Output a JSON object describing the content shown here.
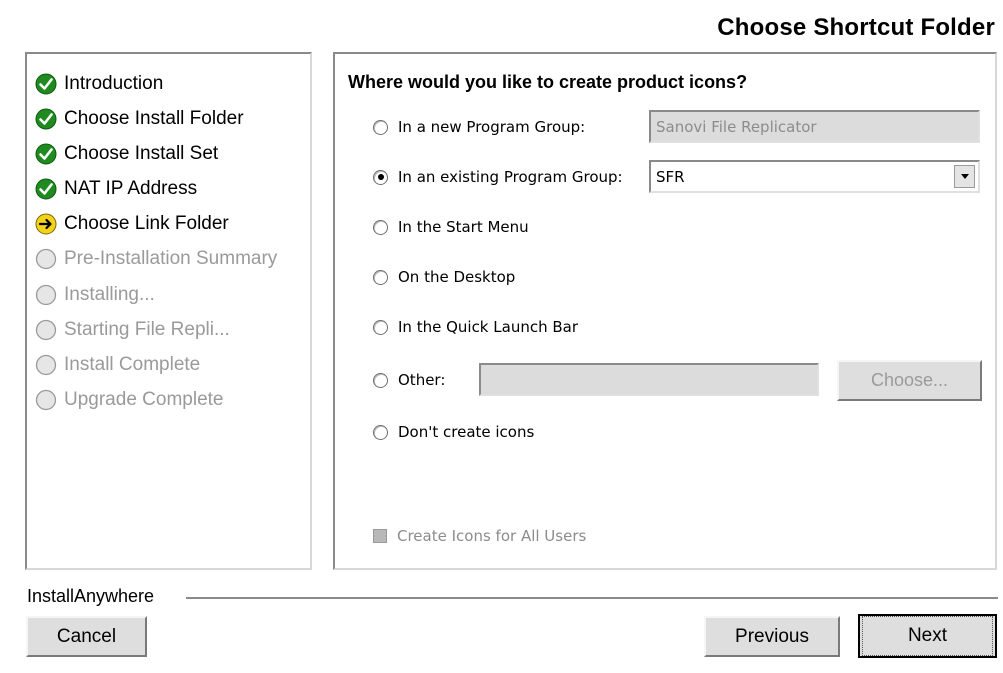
{
  "header": {
    "title": "Choose Shortcut Folder"
  },
  "steps": [
    {
      "label": "Introduction",
      "state": "done"
    },
    {
      "label": "Choose Install Folder",
      "state": "done"
    },
    {
      "label": "Choose Install Set",
      "state": "done"
    },
    {
      "label": "NAT IP Address",
      "state": "done"
    },
    {
      "label": "Choose Link Folder",
      "state": "current"
    },
    {
      "label": "Pre-Installation Summary",
      "state": "pending"
    },
    {
      "label": "Installing...",
      "state": "pending"
    },
    {
      "label": "Starting File Repli...",
      "state": "pending"
    },
    {
      "label": "Install Complete",
      "state": "pending"
    },
    {
      "label": "Upgrade Complete",
      "state": "pending"
    }
  ],
  "icons": {
    "done": "green-check-circle-icon",
    "current": "yellow-arrow-circle-icon",
    "pending": "gray-circle-icon"
  },
  "colors": {
    "done": "#1f8a1f",
    "current": "#f2d21a",
    "pending": "#c8c8c8"
  },
  "main": {
    "question": "Where would you like to create product icons?",
    "options": {
      "new_group": {
        "label": "In a new Program Group:",
        "value": "Sanovi File Replicator",
        "selected": false
      },
      "existing_group": {
        "label": "In an existing Program Group:",
        "value": "SFR",
        "selected": true
      },
      "start_menu": {
        "label": "In the Start Menu",
        "selected": false
      },
      "desktop": {
        "label": "On the Desktop",
        "selected": false
      },
      "quick_launch": {
        "label": "In the Quick Launch Bar",
        "selected": false
      },
      "other": {
        "label": "Other:",
        "value": "",
        "selected": false
      },
      "none": {
        "label": "Don't create icons",
        "selected": false
      }
    },
    "choose_button": "Choose...",
    "all_users": {
      "label": "Create Icons for All Users",
      "checked": true,
      "enabled": false
    }
  },
  "footer": {
    "brand": "InstallAnywhere",
    "cancel": "Cancel",
    "previous": "Previous",
    "next": "Next"
  }
}
